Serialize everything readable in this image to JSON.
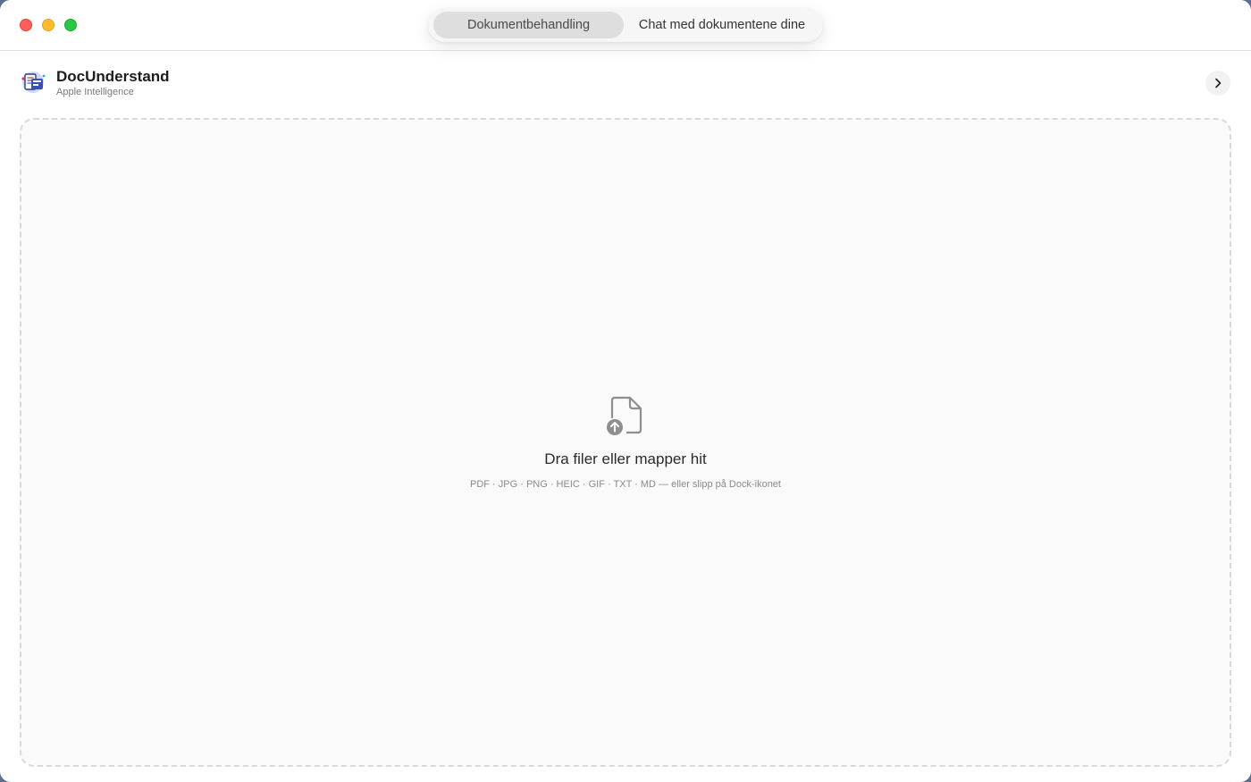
{
  "titlebar": {
    "tabs": [
      {
        "label": "Dokumentbehandling",
        "active": true
      },
      {
        "label": "Chat med dokumentene dine",
        "active": false
      }
    ]
  },
  "header": {
    "app_name": "DocUnderstand",
    "app_subtitle": "Apple Intelligence",
    "expand_icon": "chevron-right-icon"
  },
  "dropzone": {
    "icon": "document-upload-icon",
    "title": "Dra filer eller mapper hit",
    "subtitle": "PDF · JPG · PNG · HEIC · GIF · TXT · MD — eller slipp på Dock-ikonet"
  },
  "colors": {
    "close": "#ff5f57",
    "minimize": "#febc2e",
    "zoom": "#28c840",
    "active_tab_bg": "#dedede",
    "dropzone_border": "#d9d9d9"
  }
}
